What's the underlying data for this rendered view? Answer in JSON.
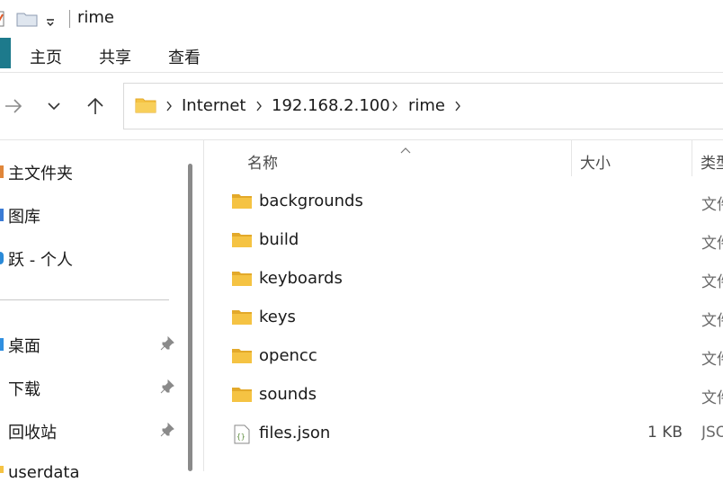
{
  "window": {
    "title": "rime"
  },
  "ribbon": {
    "tabs": [
      "主页",
      "共享",
      "查看"
    ]
  },
  "address": {
    "crumbs": [
      "Internet",
      "192.168.2.100",
      "rime"
    ]
  },
  "sidebar": {
    "items": [
      {
        "label": "主文件夹",
        "pinned": false
      },
      {
        "label": "图库",
        "pinned": false
      },
      {
        "label": "跃 - 个人",
        "pinned": false
      },
      {
        "label": "桌面",
        "pinned": true
      },
      {
        "label": "下载",
        "pinned": true
      },
      {
        "label": "回收站",
        "pinned": true
      },
      {
        "label": "userdata",
        "pinned": false
      }
    ]
  },
  "columns": {
    "name": "名称",
    "size": "大小",
    "type": "类型"
  },
  "files": [
    {
      "name": "backgrounds",
      "size": "",
      "type": "文件夹",
      "icon": "folder-icon"
    },
    {
      "name": "build",
      "size": "",
      "type": "文件夹",
      "icon": "folder-icon"
    },
    {
      "name": "keyboards",
      "size": "",
      "type": "文件夹",
      "icon": "folder-icon"
    },
    {
      "name": "keys",
      "size": "",
      "type": "文件夹",
      "icon": "folder-icon"
    },
    {
      "name": "opencc",
      "size": "",
      "type": "文件夹",
      "icon": "folder-icon"
    },
    {
      "name": "sounds",
      "size": "",
      "type": "文件夹",
      "icon": "folder-icon"
    },
    {
      "name": "files.json",
      "size": "1 KB",
      "type": "JSON",
      "icon": "json-file-icon"
    }
  ],
  "colors": {
    "accent": "#1d7a8c",
    "folder": "#f5c343",
    "folder_dark": "#e3a92a"
  }
}
